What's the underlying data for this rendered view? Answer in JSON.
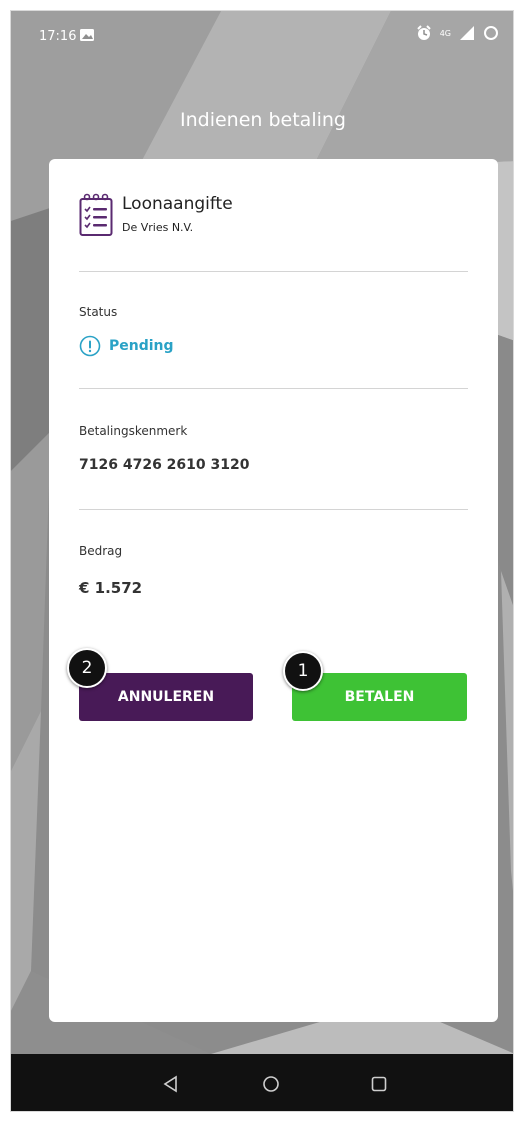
{
  "status_bar": {
    "time": "17:16",
    "signal_label": "4G",
    "icons": [
      "image-notification-icon",
      "alarm-icon",
      "signal-icon",
      "battery-icon"
    ]
  },
  "header": {
    "title": "Indienen betaling"
  },
  "document": {
    "title": "Loonaangifte",
    "company": "De Vries N.V.",
    "icon": "checklist-document-icon"
  },
  "status": {
    "label": "Status",
    "value": "Pending",
    "color": "#2aa2c6",
    "icon": "exclamation-circle-icon"
  },
  "reference": {
    "label": "Betalingskenmerk",
    "value": "7126 4726 2610 3120"
  },
  "amount": {
    "label": "Bedrag",
    "value": "€ 1.572"
  },
  "actions": {
    "cancel_label": "ANNULEREN",
    "pay_label": "BETALEN",
    "cancel_color": "#481a57",
    "pay_color": "#3ec235"
  },
  "markers": {
    "cancel_step": "2",
    "pay_step": "1"
  },
  "nav": {
    "icons": [
      "back-icon",
      "home-icon",
      "recents-icon"
    ]
  }
}
